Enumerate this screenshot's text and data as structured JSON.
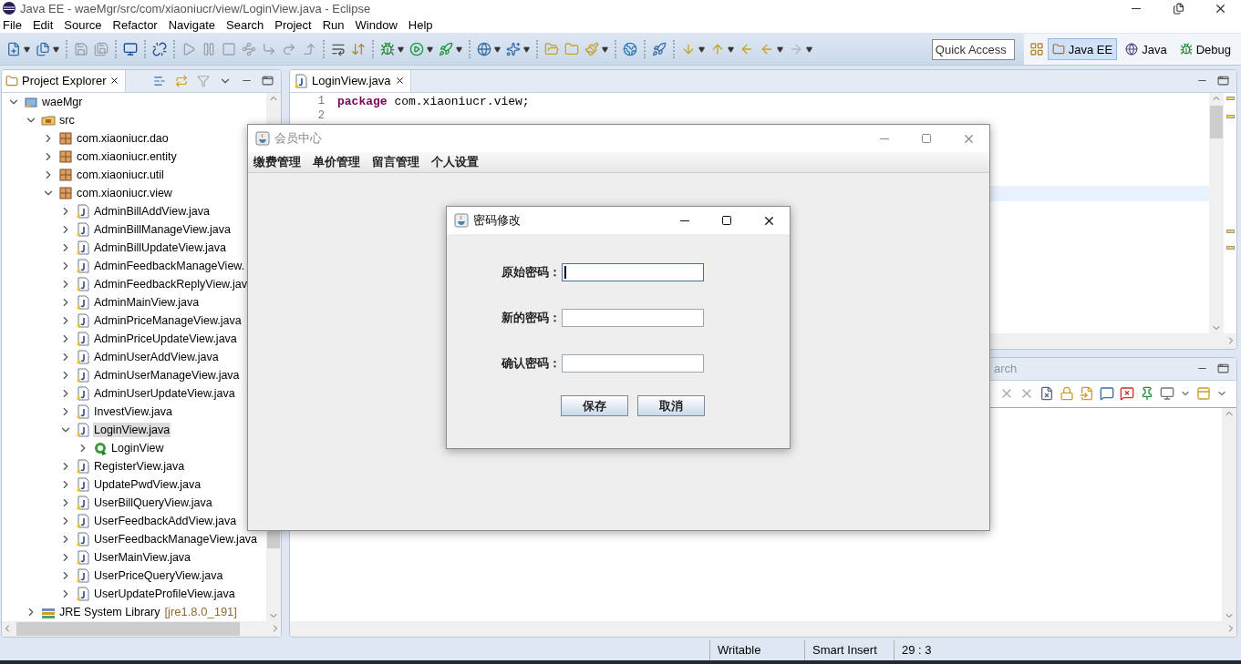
{
  "window": {
    "title": "Java EE - waeMgr/src/com/xiaoniucr/view/LoginView.java - Eclipse"
  },
  "menu": [
    "File",
    "Edit",
    "Source",
    "Refactor",
    "Navigate",
    "Search",
    "Project",
    "Run",
    "Window",
    "Help"
  ],
  "quick_access": {
    "placeholder": "Quick Access"
  },
  "perspectives": [
    {
      "label": "Java EE",
      "selected": true
    },
    {
      "label": "Java",
      "selected": false
    },
    {
      "label": "Debug",
      "selected": false
    }
  ],
  "project_explorer": {
    "tab": "Project Explorer",
    "tree": [
      {
        "kind": "project",
        "label": "waeMgr",
        "expanded": true,
        "selected": false,
        "children": [
          {
            "kind": "source-folder",
            "label": "src",
            "expanded": true,
            "selected": false,
            "children": [
              {
                "kind": "package",
                "label": "com.xiaoniucr.dao",
                "expanded": false,
                "selected": false
              },
              {
                "kind": "package",
                "label": "com.xiaoniucr.entity",
                "expanded": false,
                "selected": false
              },
              {
                "kind": "package",
                "label": "com.xiaoniucr.util",
                "expanded": false,
                "selected": false
              },
              {
                "kind": "package",
                "label": "com.xiaoniucr.view",
                "expanded": true,
                "selected": false,
                "children": [
                  {
                    "kind": "java-file",
                    "label": "AdminBillAddView.java",
                    "expanded": false,
                    "selected": false
                  },
                  {
                    "kind": "java-file",
                    "label": "AdminBillManageView.java",
                    "expanded": false,
                    "selected": false
                  },
                  {
                    "kind": "java-file",
                    "label": "AdminBillUpdateView.java",
                    "expanded": false,
                    "selected": false
                  },
                  {
                    "kind": "java-file",
                    "label": "AdminFeedbackManageView.",
                    "expanded": false,
                    "selected": false
                  },
                  {
                    "kind": "java-file",
                    "label": "AdminFeedbackReplyView.jav",
                    "expanded": false,
                    "selected": false
                  },
                  {
                    "kind": "java-file",
                    "label": "AdminMainView.java",
                    "expanded": false,
                    "selected": false
                  },
                  {
                    "kind": "java-file",
                    "label": "AdminPriceManageView.java",
                    "expanded": false,
                    "selected": false
                  },
                  {
                    "kind": "java-file",
                    "label": "AdminPriceUpdateView.java",
                    "expanded": false,
                    "selected": false
                  },
                  {
                    "kind": "java-file",
                    "label": "AdminUserAddView.java",
                    "expanded": false,
                    "selected": false
                  },
                  {
                    "kind": "java-file",
                    "label": "AdminUserManageView.java",
                    "expanded": false,
                    "selected": false
                  },
                  {
                    "kind": "java-file",
                    "label": "AdminUserUpdateView.java",
                    "expanded": false,
                    "selected": false
                  },
                  {
                    "kind": "java-file",
                    "label": "InvestView.java",
                    "expanded": false,
                    "selected": false
                  },
                  {
                    "kind": "java-file",
                    "label": "LoginView.java",
                    "expanded": true,
                    "selected": true,
                    "children": [
                      {
                        "kind": "class",
                        "label": "LoginView",
                        "expanded": false,
                        "selected": false
                      }
                    ]
                  },
                  {
                    "kind": "java-file",
                    "label": "RegisterView.java",
                    "expanded": false,
                    "selected": false
                  },
                  {
                    "kind": "java-file",
                    "label": "UpdatePwdView.java",
                    "expanded": false,
                    "selected": false
                  },
                  {
                    "kind": "java-file",
                    "label": "UserBillQueryView.java",
                    "expanded": false,
                    "selected": false
                  },
                  {
                    "kind": "java-file",
                    "label": "UserFeedbackAddView.java",
                    "expanded": false,
                    "selected": false
                  },
                  {
                    "kind": "java-file",
                    "label": "UserFeedbackManageView.java",
                    "expanded": false,
                    "selected": false
                  },
                  {
                    "kind": "java-file",
                    "label": "UserMainView.java",
                    "expanded": false,
                    "selected": false
                  },
                  {
                    "kind": "java-file",
                    "label": "UserPriceQueryView.java",
                    "expanded": false,
                    "selected": false
                  },
                  {
                    "kind": "java-file",
                    "label": "UserUpdateProfileView.java",
                    "expanded": false,
                    "selected": false
                  }
                ]
              }
            ]
          },
          {
            "kind": "library",
            "label": "JRE System Library",
            "decoration": "[jre1.8.0_191]",
            "expanded": false,
            "selected": false
          }
        ]
      }
    ]
  },
  "editor": {
    "tab": "LoginView.java",
    "lines": [
      {
        "number": "1",
        "tokens": [
          {
            "kind": "keyword",
            "text": "package"
          },
          {
            "kind": "plain",
            "text": " com.xiaoniucr.view;"
          }
        ]
      },
      {
        "number": "2"
      }
    ]
  },
  "bottom_panel": {
    "tab": "arch"
  },
  "status_bar": [
    "Writable",
    "Smart Insert",
    "29 : 3"
  ],
  "member_window": {
    "title": "会员中心",
    "menu": [
      "缴费管理",
      "单价管理",
      "留言管理",
      "个人设置"
    ]
  },
  "password_dialog": {
    "title": "密码修改",
    "fields": [
      {
        "label": "原始密码：",
        "focused": true
      },
      {
        "label": "新的密码：",
        "focused": false
      },
      {
        "label": "确认密码：",
        "focused": false
      }
    ],
    "buttons": [
      "保存",
      "取消"
    ]
  }
}
